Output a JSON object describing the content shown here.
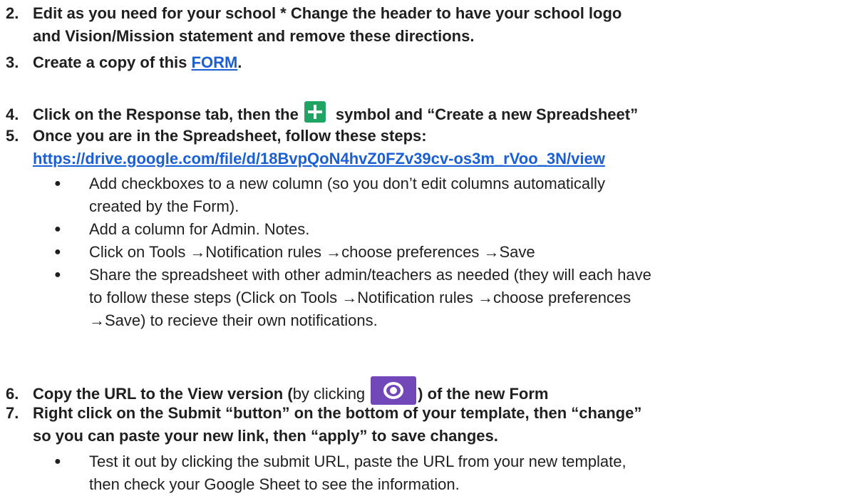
{
  "steps": {
    "s2": {
      "num": "2.",
      "line1": "Edit as you need for your school * Change the header to have your school logo",
      "line2": "and Vision/Mission statement and remove these directions."
    },
    "s3": {
      "num": "3.",
      "prefix": "Create a copy of this ",
      "link": "FORM",
      "suffix": "."
    },
    "s4": {
      "num": "4.",
      "prefix": "Click on the Response tab, then the",
      "icon": "green-plus-icon",
      "suffix": "symbol and “Create a new Spreadsheet”"
    },
    "s5": {
      "num": "5.",
      "line1": "Once you are in the Spreadsheet, follow these steps:",
      "link": "https://drive.google.com/file/d/18BvpQoN4hvZ0FZv39cv-os3m_rVoo_3N/view",
      "bullets": [
        "Add checkboxes to a new column (so you don’t edit columns automatically",
        "created by the Form).",
        "Add a column for Admin. Notes.",
        "Click on Tools →Notification rules →choose preferences →Save",
        "Share the spreadsheet with other admin/teachers as needed (they will each have",
        "to follow these steps (Click on Tools →Notification rules →choose preferences",
        "→Save) to recieve their own notifications."
      ]
    },
    "s6": {
      "num": "6.",
      "prefix": "Copy the URL to the View version (",
      "middle": "by clicking",
      "icon": "purple-eye-icon",
      "suffix": ") of the new Form"
    },
    "s7": {
      "num": "7.",
      "line1": "Right click on the Submit “button” on the bottom of your template, then “change”",
      "line2": "so you can paste your new link, then “apply” to save changes.",
      "bullets": [
        "Test it out by clicking the submit URL, paste the URL from your new template,",
        "then check your Google Sheet to see the information."
      ]
    }
  },
  "bullet_glyph": "●",
  "colors": {
    "text": "#1f1f1f",
    "link": "#1a5fd6",
    "plus_icon_bg": "#1fa463",
    "eye_icon_bg": "#7248b9"
  }
}
